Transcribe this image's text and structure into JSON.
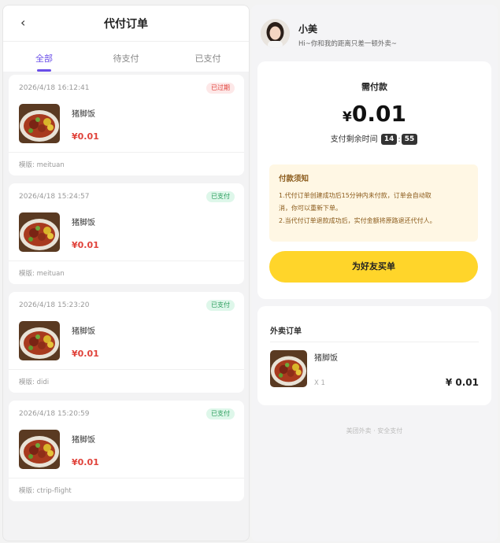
{
  "left": {
    "title": "代付订单",
    "back_glyph": "‹",
    "tabs": [
      {
        "label": "全部",
        "active": true
      },
      {
        "label": "待支付",
        "active": false
      },
      {
        "label": "已支付",
        "active": false
      }
    ],
    "orders": [
      {
        "time": "2026/4/18 16:12:41",
        "status": "已过期",
        "status_type": "expired",
        "name": "猪脚饭",
        "price": "¥0.01",
        "template": "模版: meituan"
      },
      {
        "time": "2026/4/18 15:24:57",
        "status": "已支付",
        "status_type": "paid",
        "name": "猪脚饭",
        "price": "¥0.01",
        "template": "模版: meituan"
      },
      {
        "time": "2026/4/18 15:23:20",
        "status": "已支付",
        "status_type": "paid",
        "name": "猪脚饭",
        "price": "¥0.01",
        "template": "模版: didi"
      },
      {
        "time": "2026/4/18 15:20:59",
        "status": "已支付",
        "status_type": "paid",
        "name": "猪脚饭",
        "price": "¥0.01",
        "template": "模版: ctrip-flight"
      }
    ]
  },
  "right": {
    "user": {
      "name": "小美",
      "subtitle": "Hi~你和我的距离只差一顿外卖~"
    },
    "payment": {
      "label": "需付款",
      "currency": "¥",
      "amount": "0.01",
      "timer_label": "支付剩余时间",
      "minutes": "14",
      "seconds": "55",
      "timer_sep": ":"
    },
    "notice": {
      "title": "付款须知",
      "lines": [
        "1.代付订单创建成功后15分钟内未付款，订单会自动取",
        "消，你可以重新下单。",
        "2.当代付订单退款成功后，实付金额将原路退还代付人。"
      ]
    },
    "buy_button": "为好友买单",
    "order": {
      "title": "外卖订单",
      "item_name": "猪脚饭",
      "qty": "X 1",
      "price": "¥ 0.01"
    },
    "footer": "美团外卖 · 安全支付"
  },
  "colors": {
    "accent": "#6a4ee8",
    "price_red": "#e0423a",
    "button_yellow": "#ffd52a",
    "paid_green": "#2a9d5c"
  }
}
